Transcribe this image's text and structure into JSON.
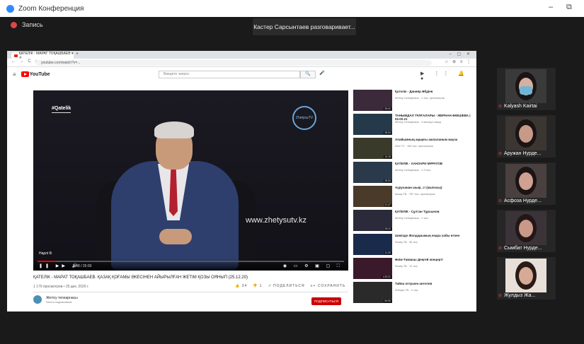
{
  "window": {
    "title": "Zoom Конференция",
    "minimize": "–",
    "maximize": "⧉"
  },
  "recording": {
    "label": "Запись"
  },
  "speaker_notice": "Кастер Сарсынтаев разговаривает...",
  "browser": {
    "tab_title": "ҚАТЕЛІК - МАРАТ ТОҚАШБАЕВ ▾ ✕",
    "new_tab": "+",
    "window_controls": "– ▢ ✕",
    "nav": "← → C ⌂",
    "url": "youtube.com/watch?v=...",
    "extensions": "☆ ⊕ ≡ ⋮"
  },
  "youtube": {
    "menu_icon": "≡",
    "logo_text": "YouTube",
    "search_placeholder": "Введите запрос",
    "search_icon": "🔍",
    "mic_icon": "🎤",
    "right_icons": "▶ ⋮⋮ 🔔 ●",
    "player": {
      "hashtag": "#Qatelik",
      "channel_logo": "ZhetysuTV",
      "watermark": "www.zhetysutv.kz",
      "episode_label": "Нарлі бі",
      "progress": 0.06,
      "controls_left": "❚❚ ▶▶ 🔊",
      "time": "0:48 / 25:00",
      "controls_right": "◉ ▭ ⚙ ▣ ▢ ⛶"
    },
    "video_title": "ҚАТЕЛІК - МАРАТ ТОҚАШБАЕВ. ҚАЗАҚ ҚОҒАМЫ ӘКЕСІНЕН АЙЫРЫЛҒАН ЖЕТІМ ҚОЗЫ ОЯНЫП (25.12.20)",
    "video_meta": "1 170 просмотров • 25 дек. 2020 г.",
    "actions": [
      "👍 34",
      "👎 1",
      "↗ ПОДЕЛИТЬСЯ",
      "≡+ СОХРАНИТЬ",
      "⋯"
    ],
    "channel_name": "Жетісу телеарнасы",
    "channel_subs": "Nnnnn подписчиков",
    "subscribe": "ПОДПИСАТЬСЯ",
    "recommendations": [
      {
        "title": "Қателік - Данияр Әбдіев",
        "meta": "Жетісу телеарнасы · 1 тыс. просмотров",
        "dur": "25:41",
        "color": "#3a2a3a"
      },
      {
        "title": "ТАНЫМДАЛ ТҰЛҒАЛАРЫ - ЖЕРНАН ӘКЕШЕВА | 02.02.21",
        "meta": "Жетісу телеарнасы · 3 месяца назад",
        "dur": "25:04",
        "color": "#243a4a"
      },
      {
        "title": "Апайымның ақырғы ашпаланым мауза",
        "meta": "Zere TV · 160 тыс. просмотров",
        "dur": "14:15",
        "color": "#3a3a2a"
      },
      {
        "title": "ҚАТЕЛІК - ХАНЗАРИ МҰРАТОВ",
        "meta": "Жетісу телеарнасы · 1,3 тыс.",
        "dur": "25:03",
        "color": "#2a3a4a"
      },
      {
        "title": "Ауруханан шықі...!! (жалғасы)",
        "meta": "Шашу ТВ · 787 тыс. просмотров",
        "dur": "11:47",
        "color": "#4a3a2a"
      },
      {
        "title": "ҚАТЕЛІК - Сұлтан Тұрсынов",
        "meta": "Жетісу телеарнасы · 2 тыс.",
        "dur": "25:11",
        "color": "#2a2a3a"
      },
      {
        "title": "Шәкізде Жолдарымың өзара хабы өткен",
        "meta": "Shaby ТВ · 38 тыс.",
        "dur": "11:33",
        "color": "#1a2a4a"
      },
      {
        "title": "Әнім-Тамашы Деңгей концерті",
        "meta": "Shaby ТВ · 12 тыс.",
        "dur": "1:03:21",
        "color": "#3a1a2a"
      },
      {
        "title": "Тайна оглушен ангелов",
        "meta": "Zhetysu ТВ · 2 тыс.",
        "dur": "54:00",
        "color": "#2a2a2a"
      }
    ]
  },
  "participants": [
    {
      "name": "Kalyash Kairtai",
      "bg": "#3a3a3a",
      "face": "#d8b0a0",
      "hair": "#1a1414",
      "mask": "#6fb6d6"
    },
    {
      "name": "Аружан Нурде...",
      "bg": "#3c3633",
      "face": "#c79a88",
      "hair": "#1a1414",
      "mask": ""
    },
    {
      "name": "Асфоза Нурде...",
      "bg": "#4a4040",
      "face": "#d0a090",
      "hair": "#1a1414",
      "mask": ""
    },
    {
      "name": "Сымбат Нурде...",
      "bg": "#3a3438",
      "face": "#c89888",
      "hair": "#241618",
      "mask": ""
    },
    {
      "name": "Жулдыз Жа...",
      "bg": "#e8e0d8",
      "face": "#d6aa96",
      "hair": "#2a1a16",
      "mask": ""
    }
  ]
}
